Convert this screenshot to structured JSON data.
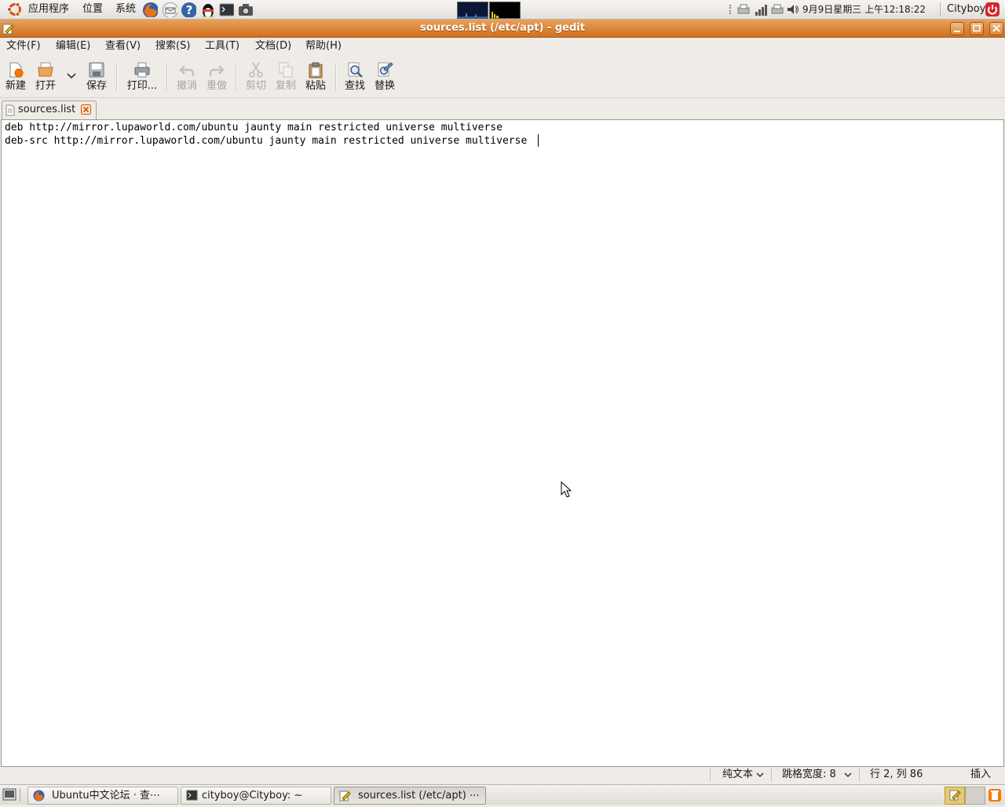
{
  "top_panel": {
    "menus": [
      "应用程序",
      "位置",
      "系统"
    ],
    "clock": "9月9日星期三 上午12:18:22",
    "user": "Cityboy"
  },
  "window": {
    "title": "sources.list (/etc/apt) - gedit"
  },
  "menubar": [
    "文件(F)",
    "编辑(E)",
    "查看(V)",
    "搜索(S)",
    "工具(T)",
    "文档(D)",
    "帮助(H)"
  ],
  "toolbar": {
    "new": "新建",
    "open": "打开",
    "save": "保存",
    "print": "打印...",
    "undo": "撤消",
    "redo": "重做",
    "cut": "剪切",
    "copy": "复制",
    "paste": "粘贴",
    "find": "查找",
    "replace": "替换"
  },
  "tab": {
    "label": "sources.list"
  },
  "editor": {
    "lines": [
      "deb http://mirror.lupaworld.com/ubuntu jaunty main restricted universe multiverse",
      "deb-src http://mirror.lupaworld.com/ubuntu jaunty main restricted universe multiverse"
    ]
  },
  "statusbar": {
    "syntax": "纯文本",
    "tab_width": "跳格宽度: 8",
    "position": "行 2, 列 86",
    "mode": "插入"
  },
  "taskbar": [
    "Ubuntu中文论坛 · 查⋯",
    "cityboy@Cityboy: ~",
    "sources.list (/etc/apt) ⋯"
  ]
}
